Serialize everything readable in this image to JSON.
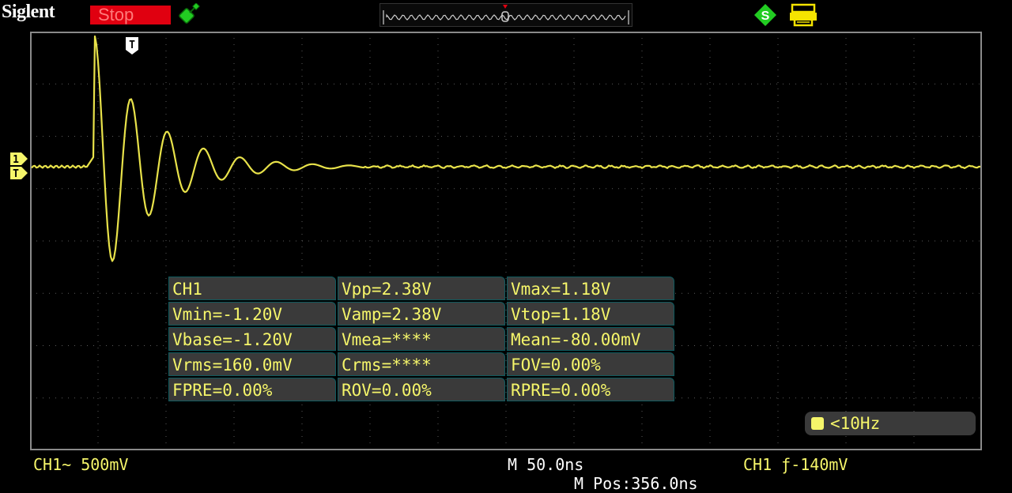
{
  "header": {
    "brand": "Siglent",
    "run_status": "Stop"
  },
  "icons": {
    "usb": "usb-icon",
    "s_badge": "s-icon",
    "s_badge_label": "S",
    "printer": "printer-icon",
    "trigger_pos": "trigger-position-icon",
    "trigger_pos_label": "T",
    "channel_marker": "channel-marker-icon",
    "channel_marker_label_top": "1",
    "channel_marker_label_bottom": "T"
  },
  "colors": {
    "trace": "#e8e24a",
    "text_yellow": "#f5f56a",
    "stop_bg": "#e00010",
    "grid": "#5a5a5a",
    "border": "#8a8a8a",
    "icon_green": "#22cc22"
  },
  "measurements": [
    [
      "CH1",
      "Vpp=2.38V",
      "Vmax=1.18V"
    ],
    [
      "Vmin=-1.20V",
      "Vamp=2.38V",
      "Vtop=1.18V"
    ],
    [
      "Vbase=-1.20V",
      "Vmea=****",
      "Mean=-80.00mV"
    ],
    [
      "Vrms=160.0mV",
      "Crms=****",
      "FOV=0.00%"
    ],
    [
      "FPRE=0.00%",
      "ROV=0.00%",
      "RPRE=0.00%"
    ]
  ],
  "frequency": "<10Hz",
  "status": {
    "ch1_scale": "CH1~ 500mV",
    "timebase": "M 50.0ns",
    "trigger": "CH1 ƒ-140mV",
    "position": "M Pos:356.0ns"
  }
}
